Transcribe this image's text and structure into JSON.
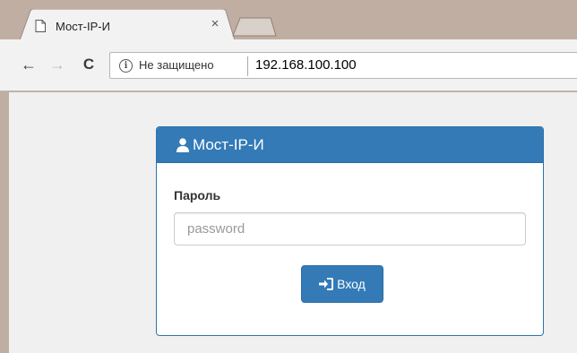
{
  "browser": {
    "tab": {
      "title": "Мост-IP-И",
      "close_glyph": "×",
      "icon": "page-icon"
    },
    "new_tab_icon": "new-tab-icon",
    "nav": {
      "back_glyph": "←",
      "forward_glyph": "→",
      "reload_glyph": "C"
    },
    "address_bar": {
      "info_glyph": "i",
      "security_label": "Не защищено",
      "url": "192.168.100.100"
    }
  },
  "login_panel": {
    "title": "Мост-IP-И",
    "user_icon": "user-icon",
    "password_label": "Пароль",
    "password_placeholder": "password",
    "password_value": "",
    "submit_label": "Вход",
    "submit_icon": "sign-in-icon"
  },
  "colors": {
    "primary": "#337ab7",
    "primary_border": "#2e6da4",
    "window_frame": "#c0aea2",
    "page_background": "#f0f0f0"
  }
}
